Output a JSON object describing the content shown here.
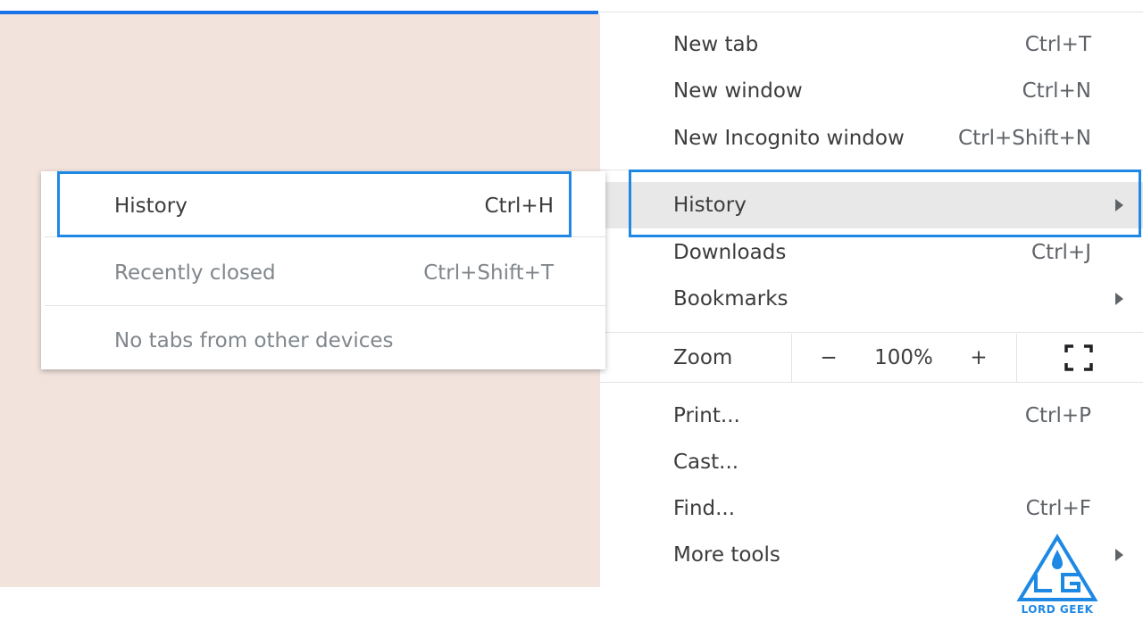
{
  "colors": {
    "page_background": "#f2e3dd",
    "loading_bar": "#1a73e8",
    "highlight_box": "#1e88e5",
    "hover_row": "#e8e8e8"
  },
  "main_menu": {
    "new_tab": {
      "label": "New tab",
      "shortcut": "Ctrl+T"
    },
    "new_window": {
      "label": "New window",
      "shortcut": "Ctrl+N"
    },
    "new_incognito": {
      "label": "New Incognito window",
      "shortcut": "Ctrl+Shift+N"
    },
    "history": {
      "label": "History",
      "icon": "chevron-right-icon"
    },
    "downloads": {
      "label": "Downloads",
      "shortcut": "Ctrl+J"
    },
    "bookmarks": {
      "label": "Bookmarks",
      "icon": "chevron-right-icon"
    },
    "zoom": {
      "label": "Zoom",
      "minus": "−",
      "level": "100%",
      "plus": "+",
      "fullscreen_icon": "fullscreen-icon"
    },
    "print": {
      "label": "Print...",
      "shortcut": "Ctrl+P"
    },
    "cast": {
      "label": "Cast..."
    },
    "find": {
      "label": "Find...",
      "shortcut": "Ctrl+F"
    },
    "more_tools": {
      "label": "More tools",
      "icon": "chevron-right-icon"
    }
  },
  "history_submenu": {
    "history": {
      "label": "History",
      "shortcut": "Ctrl+H"
    },
    "recently_closed": {
      "label": "Recently closed",
      "shortcut": "Ctrl+Shift+T"
    },
    "no_tabs": {
      "label": "No tabs from other devices"
    }
  },
  "watermark": {
    "text": "LORD GEEK",
    "icon": "lord-geek-logo-icon"
  }
}
